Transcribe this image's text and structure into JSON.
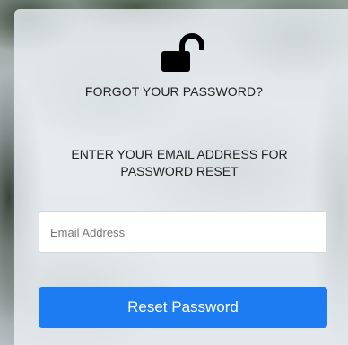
{
  "form": {
    "icon": "lock-open-icon",
    "title": "FORGOT YOUR PASSWORD?",
    "instructions": "ENTER YOUR EMAIL ADDRESS FOR PASSWORD RESET",
    "email": {
      "value": "",
      "placeholder": "Email Address"
    },
    "reset_label": "Reset Password"
  },
  "colors": {
    "accent": "#1e7cf2",
    "card": "#eef2f6",
    "text": "#222222"
  }
}
